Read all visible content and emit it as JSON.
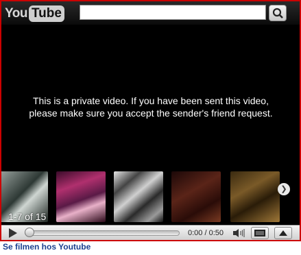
{
  "player": {
    "logo_you": "You",
    "logo_tube": "Tube",
    "search_value": "",
    "message": "This is a private video. If you have been sent this video, please make sure you accept the sender's friend request.",
    "related_count": "1-7 of 15",
    "time": "0:00 / 0:50"
  },
  "footer": {
    "link_text": "Se filmen hos Youtube"
  },
  "colors": {
    "border": "#cc0000",
    "link": "#1a3f8f"
  }
}
